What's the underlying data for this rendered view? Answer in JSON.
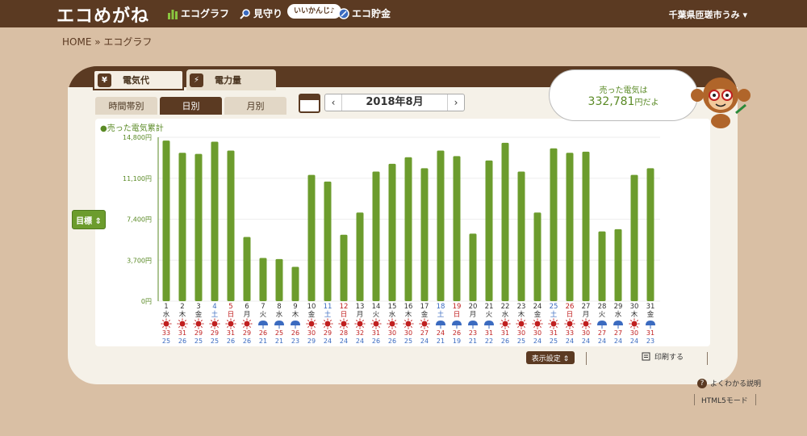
{
  "header": {
    "logo": "エコめがね",
    "nav": [
      {
        "label": "エコグラフ",
        "icon": "bar-chart-icon"
      },
      {
        "label": "見守り",
        "icon": "magnifier-icon"
      },
      {
        "label": "エコ貯金",
        "icon": "coin-icon"
      }
    ],
    "pill": "いいかんじ♪",
    "user": "千葉県匝瑳市うみ ▾"
  },
  "breadcrumb": "HOME » エコグラフ",
  "tabs": {
    "yen_badge": "¥",
    "bolt_badge": "⚡",
    "cost": "電気代",
    "energy": "電力量"
  },
  "subtabs": [
    "時間帯別",
    "日別",
    "月別"
  ],
  "date": {
    "prev": "‹",
    "label": "2018年8月",
    "next": "›"
  },
  "bubble": {
    "line1": "売った電気は",
    "amount": "332,781",
    "suffix": "円だよ"
  },
  "legend_title": "●売った電気累計",
  "goal_button": "目標 ⇕",
  "controls": {
    "display_settings": "表示設定 ⇕",
    "print": "印刷する"
  },
  "help": {
    "icon": "?",
    "label": "よくわかる説明",
    "html5": "HTML5モード"
  },
  "colors": {
    "bar": "#6c9c2d",
    "brown": "#5b3a22",
    "sat": "#3b6bc0",
    "sun": "#c02020",
    "weekday": "#333333"
  },
  "chart_data": {
    "type": "bar",
    "ylabel": "",
    "yticks": [
      "0円",
      "3,700円",
      "7,400円",
      "11,100円",
      "14,800円"
    ],
    "ylim": [
      0,
      14800
    ],
    "categories": [
      "1",
      "2",
      "3",
      "4",
      "5",
      "6",
      "7",
      "8",
      "9",
      "10",
      "11",
      "12",
      "13",
      "14",
      "15",
      "16",
      "17",
      "18",
      "19",
      "20",
      "21",
      "22",
      "23",
      "24",
      "25",
      "26",
      "27",
      "28",
      "29",
      "30",
      "31"
    ],
    "weekdays": [
      "水",
      "木",
      "金",
      "土",
      "日",
      "月",
      "火",
      "水",
      "木",
      "金",
      "土",
      "日",
      "月",
      "火",
      "水",
      "木",
      "金",
      "土",
      "日",
      "月",
      "火",
      "水",
      "木",
      "金",
      "土",
      "日",
      "月",
      "火",
      "水",
      "木",
      "金"
    ],
    "values": [
      14500,
      13400,
      13300,
      14400,
      13600,
      5800,
      3900,
      3800,
      3100,
      11400,
      10800,
      6000,
      8000,
      11700,
      12400,
      13000,
      12000,
      13600,
      13100,
      6100,
      12700,
      14300,
      11700,
      8000,
      13800,
      13400,
      13500,
      6300,
      6500,
      11400,
      12000
    ],
    "high_temp": [
      "33",
      "31",
      "29",
      "29",
      "31",
      "29",
      "26",
      "25",
      "26",
      "30",
      "29",
      "28",
      "32",
      "31",
      "30",
      "30",
      "27",
      "24",
      "26",
      "23",
      "31",
      "31",
      "30",
      "30",
      "31",
      "33",
      "30",
      "27",
      "27",
      "30",
      "31"
    ],
    "low_temp": [
      "25",
      "26",
      "25",
      "25",
      "26",
      "26",
      "21",
      "21",
      "23",
      "29",
      "24",
      "24",
      "24",
      "26",
      "26",
      "25",
      "24",
      "21",
      "19",
      "21",
      "22",
      "26",
      "25",
      "24",
      "25",
      "24",
      "24",
      "24",
      "24",
      "24",
      "23"
    ],
    "weather": [
      "sun",
      "sun",
      "sun",
      "sun",
      "sun",
      "sun",
      "rain",
      "rain",
      "rain",
      "sun",
      "sun",
      "sun",
      "sun",
      "sun",
      "sun",
      "sun",
      "sun",
      "rain",
      "rain",
      "rain",
      "rain",
      "sun",
      "sun",
      "sun",
      "sun",
      "sun",
      "sun",
      "rain",
      "rain",
      "sun",
      "rain"
    ]
  }
}
